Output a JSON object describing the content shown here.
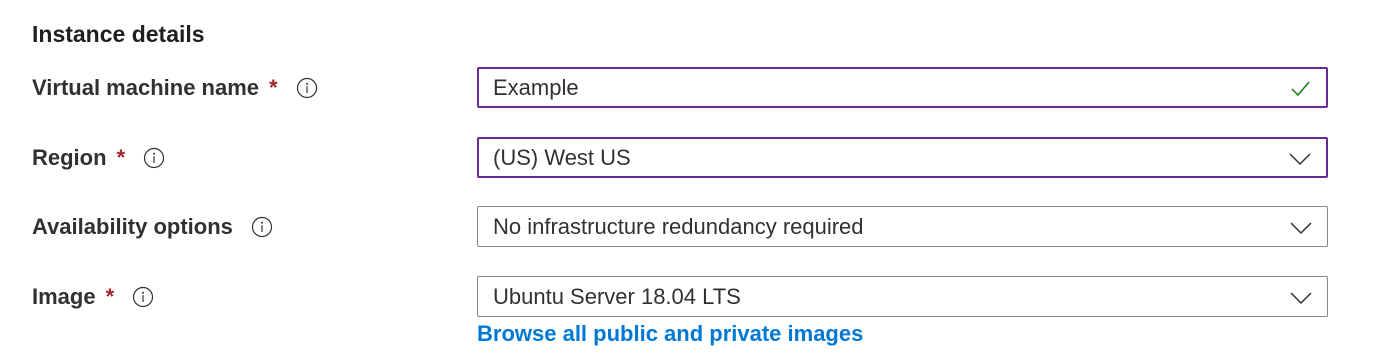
{
  "section": {
    "title": "Instance details"
  },
  "fields": {
    "vm_name": {
      "label": "Virtual machine name",
      "required_mark": "*",
      "value": "Example",
      "status_icon": "checkmark-icon"
    },
    "region": {
      "label": "Region",
      "required_mark": "*",
      "value": "(US) West US"
    },
    "availability": {
      "label": "Availability options",
      "value": "No infrastructure redundancy required"
    },
    "image": {
      "label": "Image",
      "required_mark": "*",
      "value": "Ubuntu Server 18.04 LTS"
    }
  },
  "links": {
    "browse_images": "Browse all public and private images"
  },
  "colors": {
    "required": "#a4262c",
    "focus_border": "#6b2c91",
    "border": "#8a8886",
    "link": "#0078d4",
    "success": "#107c10"
  },
  "icons": {
    "info": "info-circle-icon",
    "dropdown": "chevron-down-icon"
  }
}
